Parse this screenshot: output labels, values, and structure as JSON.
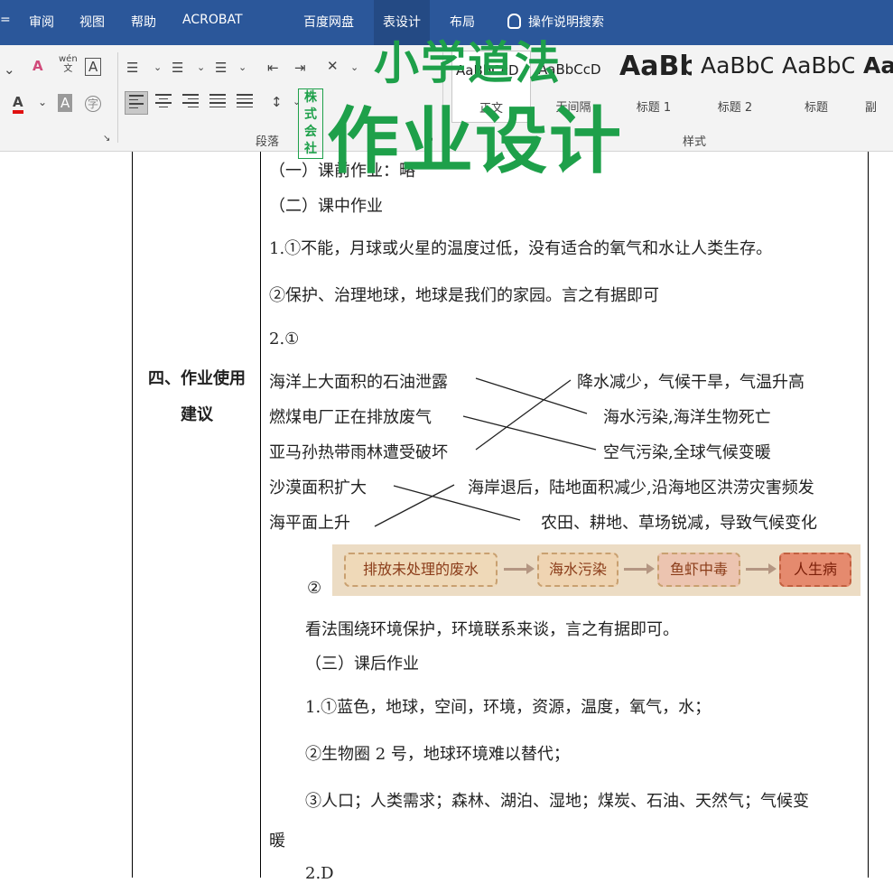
{
  "ribbon_tabs": [
    {
      "label": "审阅"
    },
    {
      "label": "视图"
    },
    {
      "label": "帮助"
    },
    {
      "label": "ACROBAT"
    },
    {
      "label": "百度网盘"
    },
    {
      "label": "表设计"
    },
    {
      "label": "布局"
    }
  ],
  "search_tab": "操作说明搜索",
  "ribbon": {
    "pinyin_icon": "wén",
    "pinyin_char": "文",
    "font_color": "A",
    "groups": {
      "paragraph": "段落",
      "styles": "样式"
    },
    "styles": [
      {
        "sample": "AaBbCcD",
        "name": "正文"
      },
      {
        "sample": "AaBbCcD",
        "name": "无间隔"
      },
      {
        "sample": "AaBb",
        "name": "标题 1"
      },
      {
        "sample": "AaBbC",
        "name": "标题 2"
      },
      {
        "sample": "AaBbC",
        "name": "标题"
      },
      {
        "sample": "Aa",
        "name": "副"
      }
    ]
  },
  "watermark": {
    "line1": "小学道法",
    "line2": "作业设计",
    "seal": "株式会社"
  },
  "document": {
    "label": {
      "line1": "四、作业使用",
      "line2": "建议"
    },
    "pre_class": "（一）课前作业：略",
    "in_class": "（二）课中作业",
    "q1_1": "1.①不能，月球或火星的温度过低，没有适合的氧气和水让人类生存。",
    "q1_2": "②保护、治理地球，地球是我们的家园。言之有据即可",
    "q2": "2.①",
    "match": {
      "left": [
        "海洋上大面积的石油泄露",
        "燃煤电厂正在排放废气",
        "亚马孙热带雨林遭受破坏",
        "沙漠面积扩大",
        "海平面上升"
      ],
      "right": [
        "降水减少，气候干旱，气温升高",
        "海水污染,海洋生物死亡",
        "空气污染,全球气候变暖",
        "海岸退后，陆地面积减少,沿海地区洪涝灾害频发",
        "农田、耕地、草场锐减，导致气候变化"
      ]
    },
    "q2_2_marker": "②",
    "flow": [
      "排放未处理的废水",
      "海水污染",
      "鱼虾中毒",
      "人生病"
    ],
    "flow_note": "看法围绕环境保护，环境联系来谈，言之有据即可。",
    "after_class": "（三）课后作业",
    "a1_1": "1.①蓝色，地球，空间，环境，资源，温度，氧气，水；",
    "a1_2": "②生物圈 2 号，地球环境难以替代；",
    "a1_3": "③人口；人类需求；森林、湖泊、湿地；煤炭、石油、天然气；气候变",
    "a1_3b": "暖",
    "a2": "2.D"
  }
}
